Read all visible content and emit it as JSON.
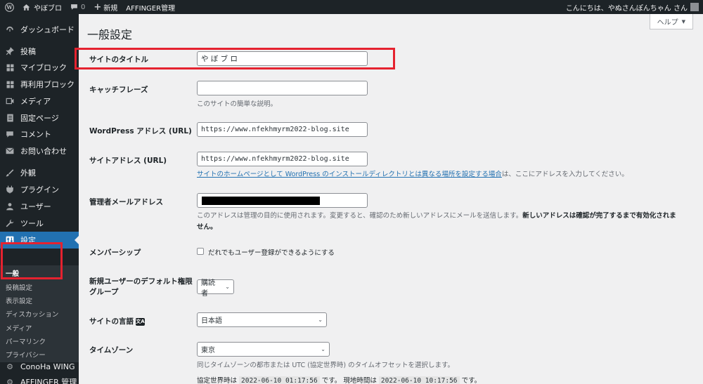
{
  "adminbar": {
    "site_name": "やぼブロ",
    "comments_count": "0",
    "new_label": "新規",
    "affinger_label": "AFFINGER管理",
    "greeting": "こんにちは、やぬさんぽんちゃん さん"
  },
  "sidebar": {
    "items": [
      {
        "label": "ダッシュボード",
        "icon": "dashboard-icon"
      },
      {
        "label": "投稿",
        "icon": "pin-icon"
      },
      {
        "label": "マイブロック",
        "icon": "grid-icon"
      },
      {
        "label": "再利用ブロック",
        "icon": "grid-icon"
      },
      {
        "label": "メディア",
        "icon": "media-icon"
      },
      {
        "label": "固定ページ",
        "icon": "page-icon"
      },
      {
        "label": "コメント",
        "icon": "comment-icon"
      },
      {
        "label": "お問い合わせ",
        "icon": "mail-icon"
      },
      {
        "label": "外観",
        "icon": "brush-icon"
      },
      {
        "label": "プラグイン",
        "icon": "plugin-icon"
      },
      {
        "label": "ユーザー",
        "icon": "user-icon"
      },
      {
        "label": "ツール",
        "icon": "wrench-icon"
      },
      {
        "label": "設定",
        "icon": "settings-icon"
      },
      {
        "label": "ConoHa WING",
        "icon": "gear-icon"
      },
      {
        "label": "AFFINGER 管理",
        "icon": "gear-icon"
      }
    ],
    "submenu": [
      "一般",
      "投稿設定",
      "表示設定",
      "ディスカッション",
      "メディア",
      "パーマリンク",
      "プライバシー"
    ]
  },
  "page": {
    "title": "一般設定",
    "help_label": "ヘルプ"
  },
  "form": {
    "site_title": {
      "label": "サイトのタイトル",
      "value": "や ぼ ブ ロ"
    },
    "tagline": {
      "label": "キャッチフレーズ",
      "value": "",
      "description": "このサイトの簡単な説明。"
    },
    "wp_address": {
      "label": "WordPress アドレス (URL)",
      "value": "https://www.nfekhmyrm2022-blog.site"
    },
    "site_address": {
      "label": "サイトアドレス (URL)",
      "value": "https://www.nfekhmyrm2022-blog.site",
      "desc_link": "サイトのホームページとして WordPress のインストールディレクトリとは異なる場所を設定する場合",
      "desc_rest": "は、ここにアドレスを入力してください。"
    },
    "admin_email": {
      "label": "管理者メールアドレス",
      "desc_line1": "このアドレスは管理の目的に使用されます。変更すると、確認のため新しいアドレスにメールを送信します。",
      "desc_bold1": "新しいアドレスは確認が完了するまで有効化されま",
      "desc_bold2": "せん。"
    },
    "membership": {
      "label": "メンバーシップ",
      "checkbox_label": "だれでもユーザー登録ができるようにする"
    },
    "default_role": {
      "label": "新規ユーザーのデフォルト権限グループ",
      "value": "購読者"
    },
    "site_language": {
      "label": "サイトの言語",
      "value": "日本語"
    },
    "timezone": {
      "label": "タイムゾーン",
      "value": "東京",
      "description": "同じタイムゾーンの都市または UTC (協定世界時) のタイムオフセットを選択します。",
      "utc_label": "協定世界時は",
      "utc_time": "2022-06-10 01:17:56",
      "local_label": "です。 現地時間は",
      "local_time": "2022-06-10 10:17:56",
      "tail": "です。"
    }
  },
  "colors": {
    "adminbar_bg": "#1d2327",
    "menu_current": "#2271b1",
    "annotation_red": "#e5222f"
  }
}
